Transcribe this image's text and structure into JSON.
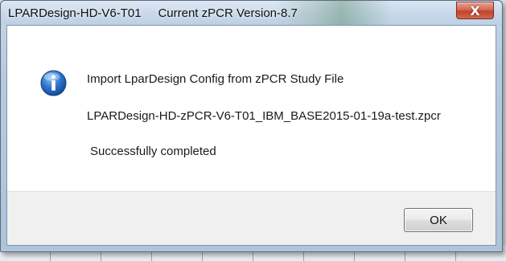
{
  "window": {
    "title": "LPARDesign-HD-V6-T01     Current zPCR Version-8.7",
    "close_glyph": "X"
  },
  "message": {
    "icon": "info-icon",
    "line1": "Import LparDesign Config from zPCR Study File",
    "line2": "LPARDesign-HD-zPCR-V6-T01_IBM_BASE2015-01-19a-test.zpcr",
    "line3": "Successfully completed"
  },
  "buttons": {
    "ok_label": "OK"
  },
  "colors": {
    "titlebar": "#c9d9ea",
    "close_button": "#c1432c",
    "info_icon": "#1f5fb5",
    "content_bg": "#ffffff",
    "footer_bg": "#f0f0f0"
  }
}
